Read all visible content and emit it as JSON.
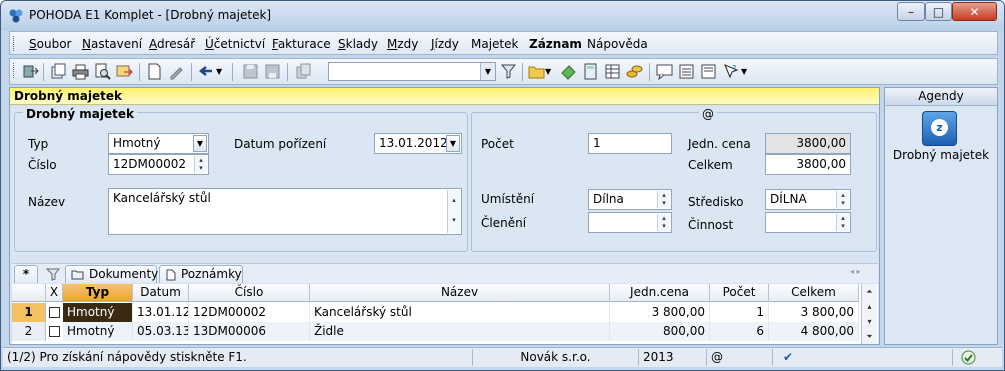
{
  "window": {
    "title": "POHODA E1 Komplet - [Drobný majetek]",
    "min": "–",
    "max": "□",
    "close": "✕"
  },
  "menu": [
    {
      "u": "S",
      "rest": "oubor"
    },
    {
      "u": "N",
      "rest": "astavení"
    },
    {
      "u": "A",
      "rest": "dresář"
    },
    {
      "u": "Ú",
      "rest": "četnictví"
    },
    {
      "u": "F",
      "rest": "akturace"
    },
    {
      "u": "S",
      "rest": "klady"
    },
    {
      "u": "M",
      "rest": "zdy"
    },
    {
      "u": "J",
      "rest": "ízdy"
    },
    {
      "u": "",
      "rest": "Majetek"
    },
    {
      "u": "",
      "rest": "Záznam"
    },
    {
      "u": "",
      "rest": "Nápověda"
    }
  ],
  "agenda": {
    "header": "Drobný majetek"
  },
  "form": {
    "section_title": "Drobný majetek",
    "at_sign": "@",
    "typ_label": "Typ",
    "typ_value": "Hmotný",
    "cislo_label": "Číslo",
    "cislo_value": "12DM00002",
    "datum_label": "Datum pořízení",
    "datum_value": "13.01.2012",
    "nazev_label": "Název",
    "nazev_value": "Kancelářský stůl",
    "pocet_label": "Počet",
    "pocet_value": "1",
    "jedn_cena_label": "Jedn. cena",
    "jedn_cena_value": "3800,00",
    "celkem_label": "Celkem",
    "celkem_value": "3800,00",
    "umisteni_label": "Umístění",
    "umisteni_value": "Dílna",
    "stredisko_label": "Středisko",
    "stredisko_value": "DÍLNA",
    "cleneni_label": "Členění",
    "cleneni_value": "",
    "cinnost_label": "Činnost",
    "cinnost_value": ""
  },
  "tabs": {
    "star": "*",
    "dokumenty": "Dokumenty",
    "poznamky": "Poznámky"
  },
  "grid": {
    "columns": {
      "x": "X",
      "typ": "Typ",
      "datum": "Datum",
      "cislo": "Číslo",
      "nazev": "Název",
      "jedn_cena": "Jedn.cena",
      "pocet": "Počet",
      "celkem": "Celkem"
    },
    "rows": [
      {
        "num": "1",
        "typ": "Hmotný",
        "datum": "13.01.12",
        "cislo": "12DM00002",
        "nazev": "Kancelářský stůl",
        "jedn_cena": "3 800,00",
        "pocet": "1",
        "celkem": "3 800,00"
      },
      {
        "num": "2",
        "typ": "Hmotný",
        "datum": "05.03.13",
        "cislo": "13DM00006",
        "nazev": "Židle",
        "jedn_cena": "800,00",
        "pocet": "6",
        "celkem": "4 800,00"
      }
    ]
  },
  "side": {
    "header": "Agendy",
    "item": "Drobný majetek"
  },
  "status": {
    "help": "(1/2) Pro získání nápovědy stiskněte F1.",
    "company": "Novák s.r.o.",
    "year": "2013",
    "at": "@",
    "check": "✔"
  }
}
